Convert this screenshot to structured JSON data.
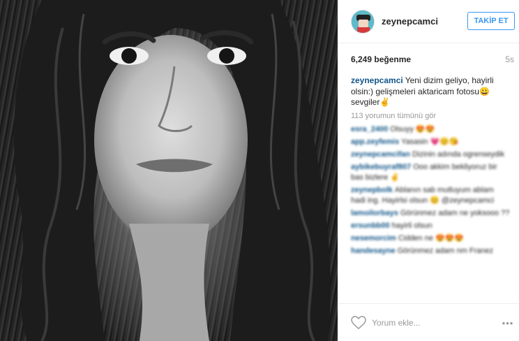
{
  "post": {
    "username": "zeynepcamci",
    "follow_label": "TAKİP ET",
    "likes": "6,249 beğenme",
    "time_ago": "5s",
    "caption_user": "zeynepcamci",
    "caption_text": "Yeni dizim geliyo, hayirli olsin:) gelişmeleri aktaricam fotosu😀 sevgiler✌",
    "view_all_comments": "113 yorumun tümünü gör",
    "comment_placeholder": "Yorum ekle...",
    "more_label": "•••"
  },
  "comments": [
    {
      "user": "esra_2400",
      "text": "Olsuyy 😍😍",
      "blurred": true
    },
    {
      "user": "app.zeyfemis",
      "text": "Yasasin 💗😊😘",
      "blurred": true
    },
    {
      "user": "zeynepcamcifan",
      "text": "Dizinin adında ogrenseydik",
      "blurred": true
    },
    {
      "user": "aybikebuyraf807",
      "text": "Ooo akkim bekliyoruz bir bas bizlere ✌",
      "blurred": true
    },
    {
      "user": "zeynepbolk",
      "text": "Ablanın sab mutluyum ablam hadi ing. Hayirlsi olsun 😊 @zeynepcamci",
      "blurred": true
    },
    {
      "user": "lamoilorbays",
      "text": "Görünmez adam ne yoksooo ??",
      "blurred": true
    },
    {
      "user": "ersunbb00",
      "text": "hayirli olsun",
      "blurred": true
    },
    {
      "user": "nesemorcim",
      "text": "Cidden ne 😍😍😍",
      "blurred": true
    },
    {
      "user": "handesayne",
      "text": "Görünmez adam nm Franez",
      "blurred": true
    }
  ],
  "icons": {
    "avatar": "profile-avatar",
    "like": "heart-outline-icon",
    "more": "more-dots-icon"
  },
  "colors": {
    "accent": "#3897f0",
    "username": "#125688",
    "muted": "#999999"
  }
}
